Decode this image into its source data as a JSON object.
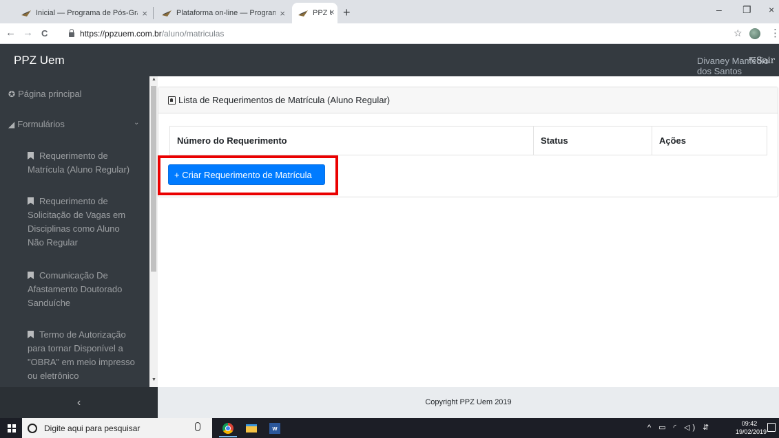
{
  "browser": {
    "tabs": [
      {
        "title": "Inicial — Programa de Pós-Gradu"
      },
      {
        "title": "Plataforma on-line — Programa"
      },
      {
        "title": "PPZ Uem"
      }
    ],
    "new_tab_glyph": "+",
    "close_glyph": "×",
    "url_host": "https://ppzuem.com.br",
    "url_path": "/aluno/matriculas",
    "icons": {
      "back": "←",
      "forward": "→",
      "reload": "C",
      "star": "☆",
      "menu": "⋮",
      "minimize": "–",
      "maximize": "❐",
      "close": "×"
    }
  },
  "header": {
    "brand": "PPZ Uem",
    "user_name": "Divaney Mamédio dos Santos",
    "logout_label": "⇱Sair"
  },
  "sidebar": {
    "home_label": "Página principal",
    "forms_label": "Formulários",
    "forms_chevron": "⌄",
    "sub_items": [
      "Requerimento de Matrícula (Aluno Regular)",
      "Requerimento de Solicitação de Vagas em Disciplinas como Aluno Não Regular",
      "Comunicação De Afastamento Doutorado Sanduíche",
      "Termo de Autorização para tornar Disponível a \"OBRA\" em meio impresso ou eletrônico"
    ],
    "toggle_glyph": "‹"
  },
  "main": {
    "card_title": "Lista de Requerimentos de Matrícula (Aluno Regular)",
    "table_headers": [
      "Número do Requerimento",
      "Status",
      "Ações"
    ],
    "create_button": "+ Criar Requerimento de Matrícula"
  },
  "footer": {
    "text": "Copyright PPZ Uem 2019"
  },
  "taskbar": {
    "search_placeholder": "Digite aqui para pesquisar",
    "tray_icons": "^ ▭ ◜ ◁) ⇵",
    "time": "09:42",
    "date": "19/02/2019"
  },
  "colors": {
    "accent": "#007bff",
    "highlight": "#ea0000",
    "sidebar": "#343a40"
  }
}
